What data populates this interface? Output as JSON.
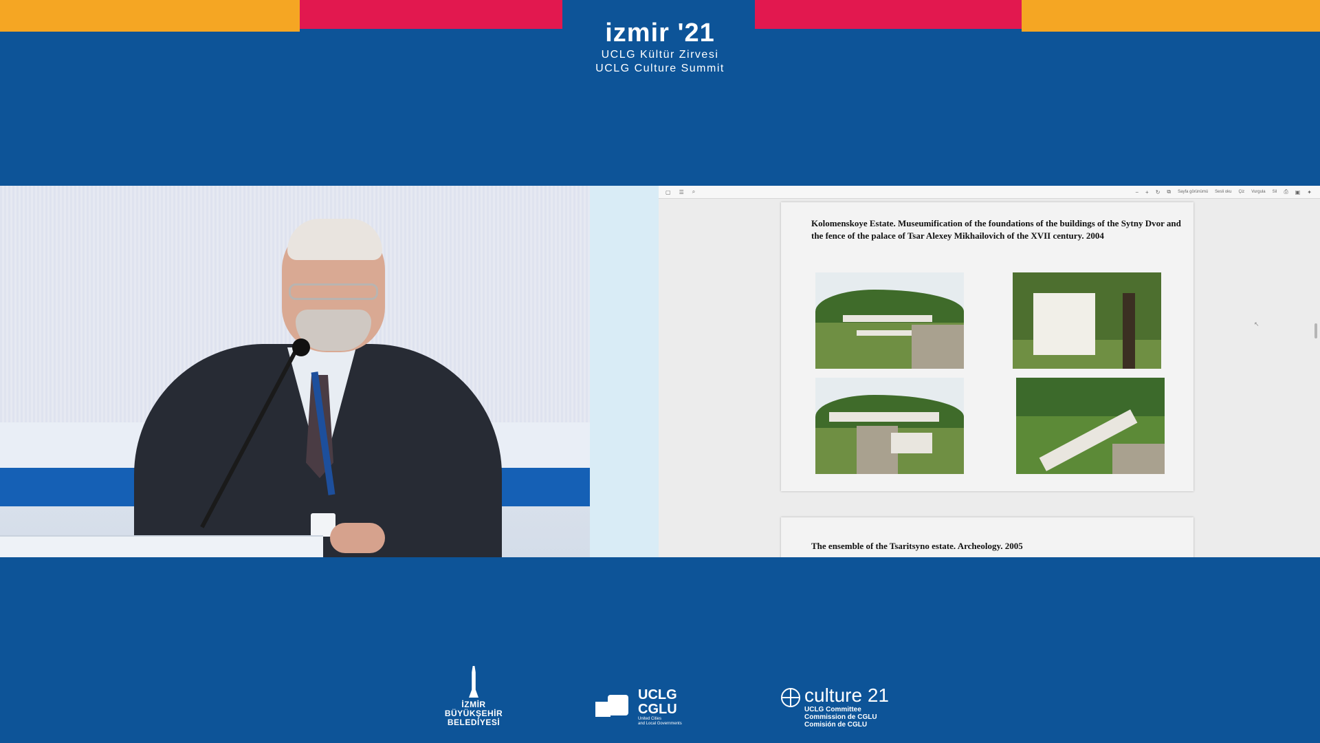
{
  "header": {
    "title": "izmir '21",
    "subtitle_tr": "UCLG Kültür Zirvesi",
    "subtitle_en": "UCLG Culture Summit"
  },
  "pdf_viewer": {
    "toolbar": {
      "left_icons": [
        "window-icon",
        "page-view-icon",
        "search-icon"
      ],
      "labels": [
        "Sayfa görünümü",
        "Sesli oku",
        "Çiz",
        "Vurgula",
        "Sil"
      ]
    },
    "page1": {
      "heading": "Kolomenskoye Estate. Museumification of the foundations of the buildings of the Sytny Dvor and the fence of the palace of Tsar Alexey Mikhailovich of the XVII century. 2004",
      "photos": [
        "foundations-photo",
        "white-building-photo",
        "stone-foundations-photo",
        "fence-foundation-photo"
      ]
    },
    "page2": {
      "heading": "The ensemble of the Tsaritsyno estate. Archeology. 2005"
    }
  },
  "footer": {
    "izmir_logo": [
      "İZMİR",
      "BÜYÜKŞEHİR",
      "BELEDİYESİ"
    ],
    "uclg_logo": {
      "lines": [
        "UCLG",
        "CGLU"
      ],
      "small": [
        "United Cities",
        "and Local Governments"
      ]
    },
    "culture_logo": {
      "name": "culture 21",
      "lines": [
        "UCLG Committee",
        "Commission de CGLU",
        "Comisión de CGLU"
      ]
    }
  },
  "colors": {
    "background": "#0d5498",
    "orange": "#f5a623",
    "magenta": "#e2184f"
  }
}
